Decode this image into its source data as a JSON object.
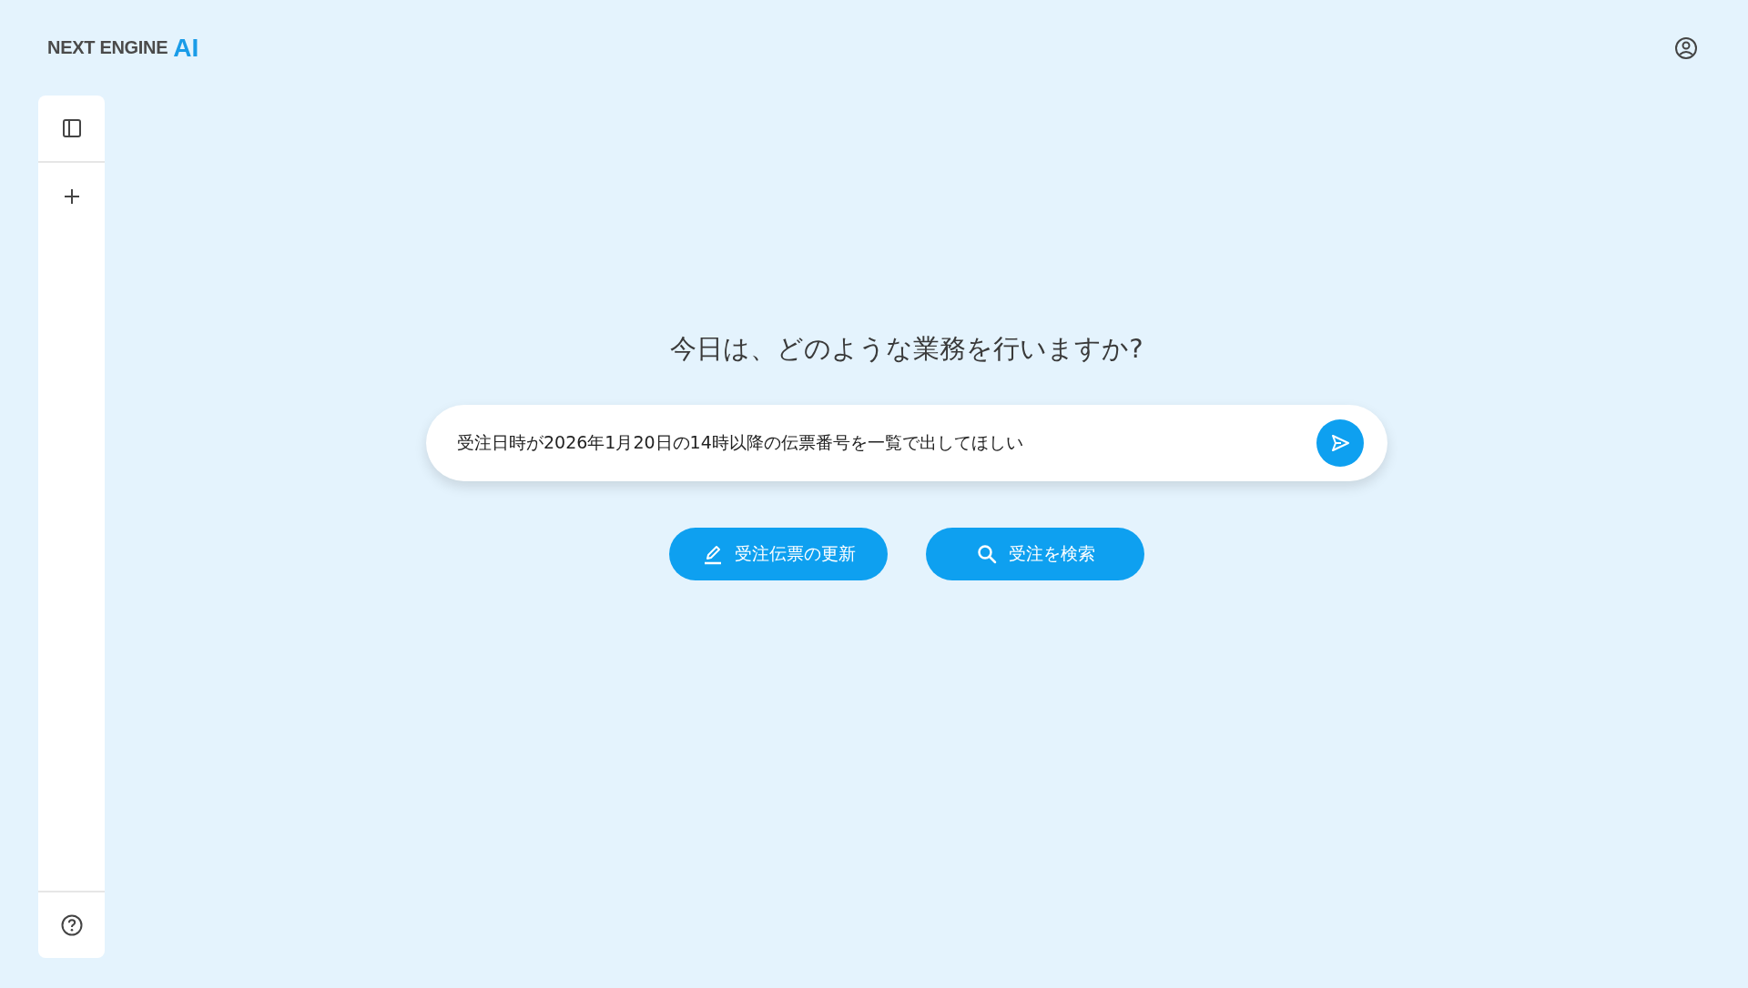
{
  "header": {
    "logo_text": "NEXT ENGINE",
    "logo_mark": "AI"
  },
  "heading": "今日は、どのような業務を行いますか?",
  "prompt": {
    "value": "受注日時が2026年1月20日の14時以降の伝票番号を一覧で出してほしい"
  },
  "actions": [
    {
      "kind": "edit",
      "label": "受注伝票の更新"
    },
    {
      "kind": "search",
      "label": "受注を検索"
    }
  ]
}
